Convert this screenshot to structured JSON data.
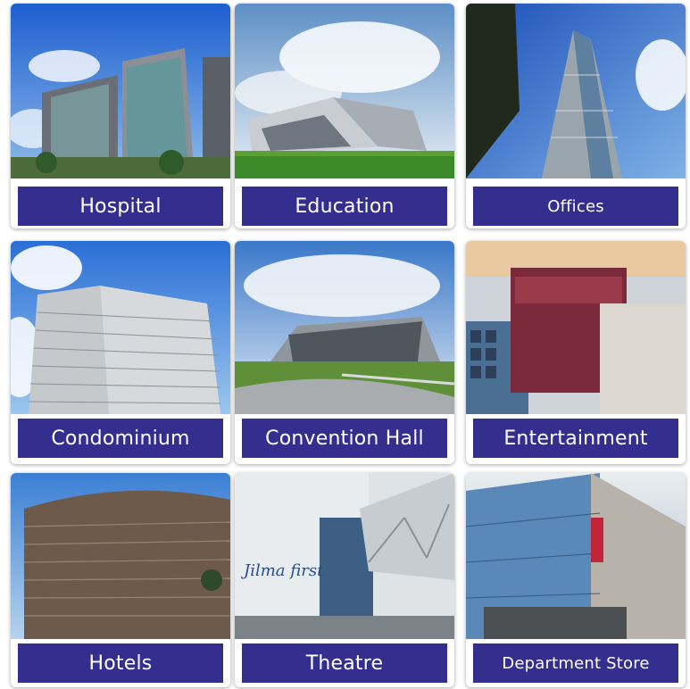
{
  "categories": [
    {
      "label": "Hospital",
      "icon": "hospital-building-photo"
    },
    {
      "label": "Education",
      "icon": "education-building-photo"
    },
    {
      "label": "Offices",
      "icon": "office-tower-photo"
    },
    {
      "label": "Condominium",
      "icon": "condominium-tower-photo"
    },
    {
      "label": "Convention Hall",
      "icon": "convention-hall-photo"
    },
    {
      "label": "Entertainment",
      "icon": "entertainment-complex-photo"
    },
    {
      "label": "Hotels",
      "icon": "hotel-tower-photo"
    },
    {
      "label": "Theatre",
      "icon": "theatre-building-photo"
    },
    {
      "label": "Department Store",
      "icon": "department-store-photo"
    }
  ],
  "colors": {
    "label_background": "#342f8f",
    "label_text": "#ffffff",
    "sky": "#2f6fd1"
  }
}
